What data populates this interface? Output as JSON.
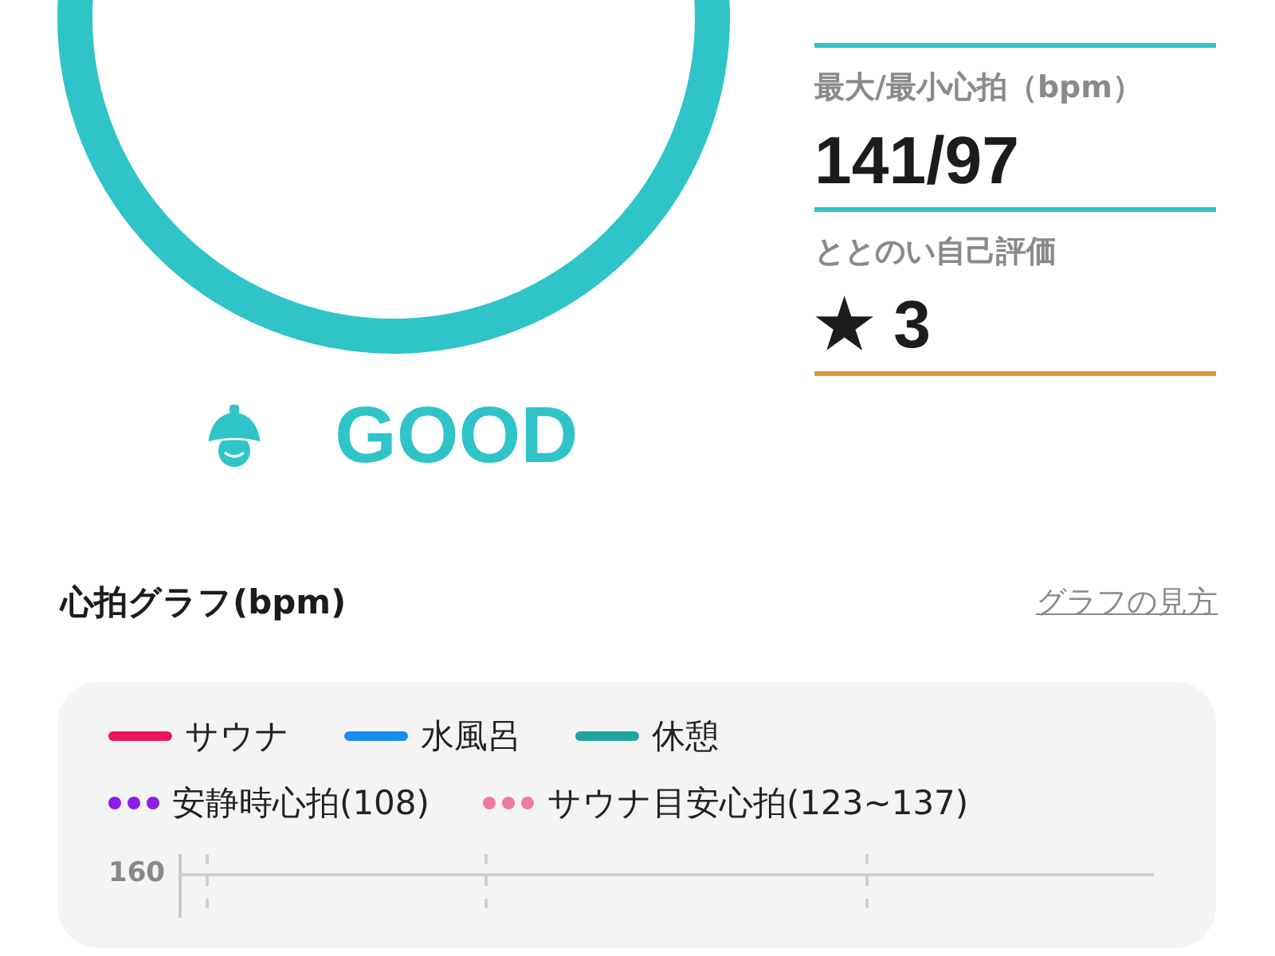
{
  "score": {
    "status": "GOOD"
  },
  "stats": [
    {
      "color": "#2ec4c8"
    },
    {
      "label": "最大/最小心拍（bpm）",
      "value": "141/97",
      "color": "#2ec4c8"
    },
    {
      "label": "ととのい自己評価",
      "value": "★ 3",
      "color": "#d9973a"
    }
  ],
  "graph": {
    "title": "心拍グラフ(bpm)",
    "help_link": "グラフの見方",
    "legend": [
      {
        "kind": "line",
        "label": "サウナ",
        "color": "#f0145a"
      },
      {
        "kind": "line",
        "label": "水風呂",
        "color": "#1a8cf0"
      },
      {
        "kind": "line",
        "label": "休憩",
        "color": "#1fa59e"
      },
      {
        "kind": "dots",
        "label": "安静時心拍(108)",
        "color": "#8a1ee6"
      },
      {
        "kind": "dots",
        "label": "サウナ目安心拍(123~137)",
        "color": "#ef7aa0"
      }
    ],
    "y_tick": "160"
  }
}
